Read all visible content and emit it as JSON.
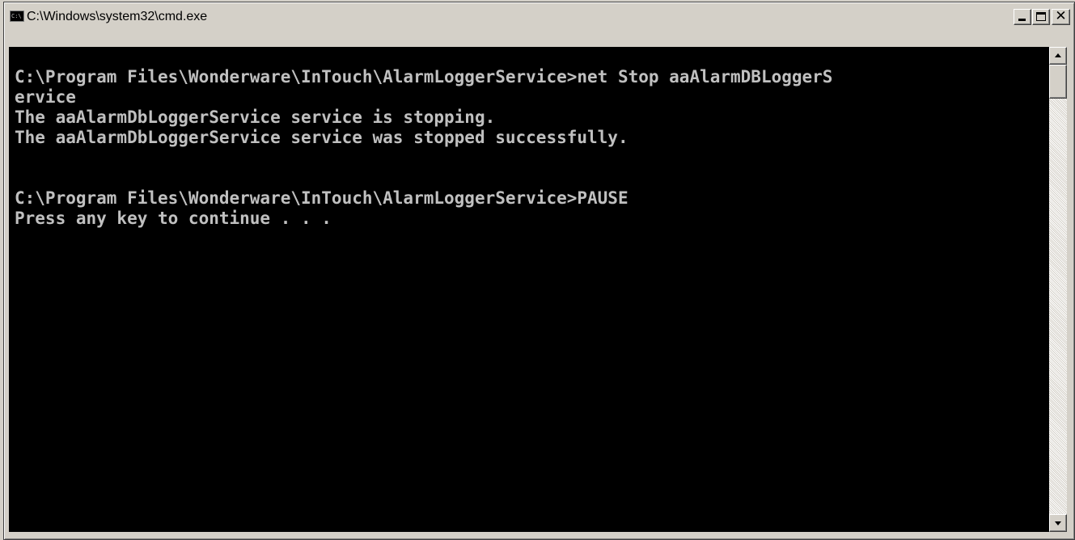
{
  "window": {
    "title": "C:\\Windows\\system32\\cmd.exe",
    "icon": "cmd-icon",
    "icon_label": "C:\\",
    "controls": {
      "minimize": "minimize-icon",
      "maximize": "maximize-icon",
      "close": "close-icon",
      "close_glyph": "✕"
    }
  },
  "console": {
    "background": "#000000",
    "foreground": "#c0c0c0",
    "lines": [
      "",
      "C:\\Program Files\\Wonderware\\InTouch\\AlarmLoggerService>net Stop aaAlarmDBLoggerS",
      "ervice",
      "The aaAlarmDbLoggerService service is stopping.",
      "The aaAlarmDbLoggerService service was stopped successfully.",
      "",
      "",
      "C:\\Program Files\\Wonderware\\InTouch\\AlarmLoggerService>PAUSE",
      "Press any key to continue . . ."
    ]
  },
  "scrollbar": {
    "up": "scroll-up-arrow-icon",
    "down": "scroll-down-arrow-icon"
  }
}
